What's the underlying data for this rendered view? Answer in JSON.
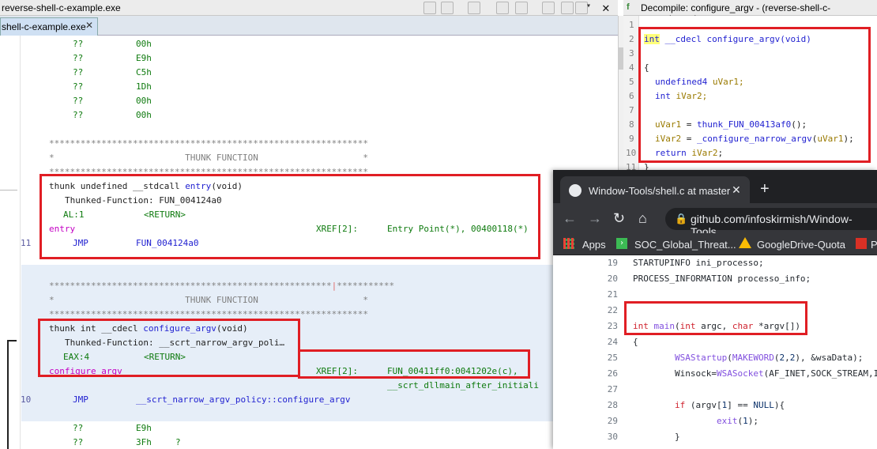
{
  "left_window": {
    "title": "reverse-shell-c-example.exe",
    "tab_label": "shell-c-example.exe",
    "tab_close": "✕"
  },
  "listing": {
    "top_bytes": [
      {
        "q": "??",
        "v": "00h"
      },
      {
        "q": "??",
        "v": "E9h"
      },
      {
        "q": "??",
        "v": "C5h"
      },
      {
        "q": "??",
        "v": "1Dh"
      },
      {
        "q": "??",
        "v": "00h"
      },
      {
        "q": "??",
        "v": "00h"
      }
    ],
    "stars": "*************************************************************",
    "thunk_banner": "*                         THUNK FUNCTION                    *",
    "entry": {
      "signature_prefix": "thunk undefined __stdcall ",
      "signature_name": "entry",
      "signature_suffix": "(void)",
      "thunked": "Thunked-Function: FUN_004124a0",
      "reg": "AL:1",
      "ret": "<RETURN>",
      "label": "entry",
      "xref_label": "XREF[2]:",
      "xref_value": "Entry Point(*), 00400118(*)",
      "line_no": "11",
      "mnemonic": "JMP",
      "operand": "FUN_004124a0"
    },
    "stars2_a": "******************************************************",
    "stars2_b": "***********",
    "configure": {
      "signature_prefix": "thunk int __cdecl ",
      "signature_name": "configure_argv",
      "signature_suffix": "(void)",
      "thunked": "Thunked-Function: __scrt_narrow_argv_poli…",
      "reg": "EAX:4",
      "ret": "<RETURN>",
      "label": "configure_argv",
      "xref_label": "XREF[2]:",
      "xref_value": "FUN_00411ff0:0041202e(c),",
      "xref_value2": "__scrt_dllmain_after_initiali",
      "line_no": "10",
      "mnemonic": "JMP",
      "operand": "__scrt_narrow_argv_policy::configure_argv"
    },
    "bottom_bytes": [
      {
        "q": "??",
        "v": "E9h",
        "c": ""
      },
      {
        "q": "??",
        "v": "3Fh",
        "c": "?"
      }
    ]
  },
  "decompile": {
    "title": "Decompile: configure_argv - (reverse-shell-c-example.exe)",
    "icon_label": "f",
    "line_numbers": [
      "1",
      "2",
      "3",
      "4",
      "5",
      "6",
      "7",
      "8",
      "9",
      "10",
      "11"
    ],
    "lines": {
      "l2_type": "int",
      "l2_rest": " __cdecl configure_argv(void)",
      "l4": "{",
      "l5_type": "undefined4",
      "l5_var": " uVar1;",
      "l6_type": "int",
      "l6_var": " iVar2;",
      "l8_a": "uVar1",
      "l8_b": " = ",
      "l8_c": "thunk_FUN_00413af0",
      "l8_d": "();",
      "l9_a": "iVar2",
      "l9_b": " = ",
      "l9_c": "_configure_narrow_argv",
      "l9_d": "(",
      "l9_e": "uVar1",
      "l9_f": ");",
      "l10_a": "return ",
      "l10_b": "iVar2",
      "l10_c": ";",
      "l11": "}"
    }
  },
  "browser": {
    "tab_title": "Window-Tools/shell.c at master ·",
    "tab_close": "✕",
    "new_tab": "+",
    "url": "github.com/infoskirmish/Window-Tools",
    "bookmarks": [
      {
        "label": "Apps",
        "icon": "apps-grid-icon"
      },
      {
        "label": "SOC_Global_Threat...",
        "icon": "arrow-icon"
      },
      {
        "label": "GoogleDrive-Quota",
        "icon": "drive-icon"
      },
      {
        "label": "P",
        "icon": "bookmark-icon"
      }
    ],
    "code": [
      {
        "n": "19",
        "t": "STARTUPINFO ini_processo;"
      },
      {
        "n": "20",
        "t": "PROCESS_INFORMATION processo_info;"
      },
      {
        "n": "21",
        "t": ""
      },
      {
        "n": "22",
        "t": ""
      },
      {
        "n": "23",
        "t": "int main(int argc, char *argv[])"
      },
      {
        "n": "24",
        "t": "{"
      },
      {
        "n": "25",
        "t": "        WSAStartup(MAKEWORD(2,2), &wsaData);"
      },
      {
        "n": "26",
        "t": "        Winsock=WSASocket(AF_INET,SOCK_STREAM,I"
      },
      {
        "n": "27",
        "t": ""
      },
      {
        "n": "28",
        "t": "        if (argv[1] == NULL){"
      },
      {
        "n": "29",
        "t": "                exit(1);"
      },
      {
        "n": "30",
        "t": "        }"
      }
    ]
  },
  "colors": {
    "highlight_red": "#e01e24",
    "selection_band": "#e6eef8",
    "browser_dark": "#202124"
  }
}
